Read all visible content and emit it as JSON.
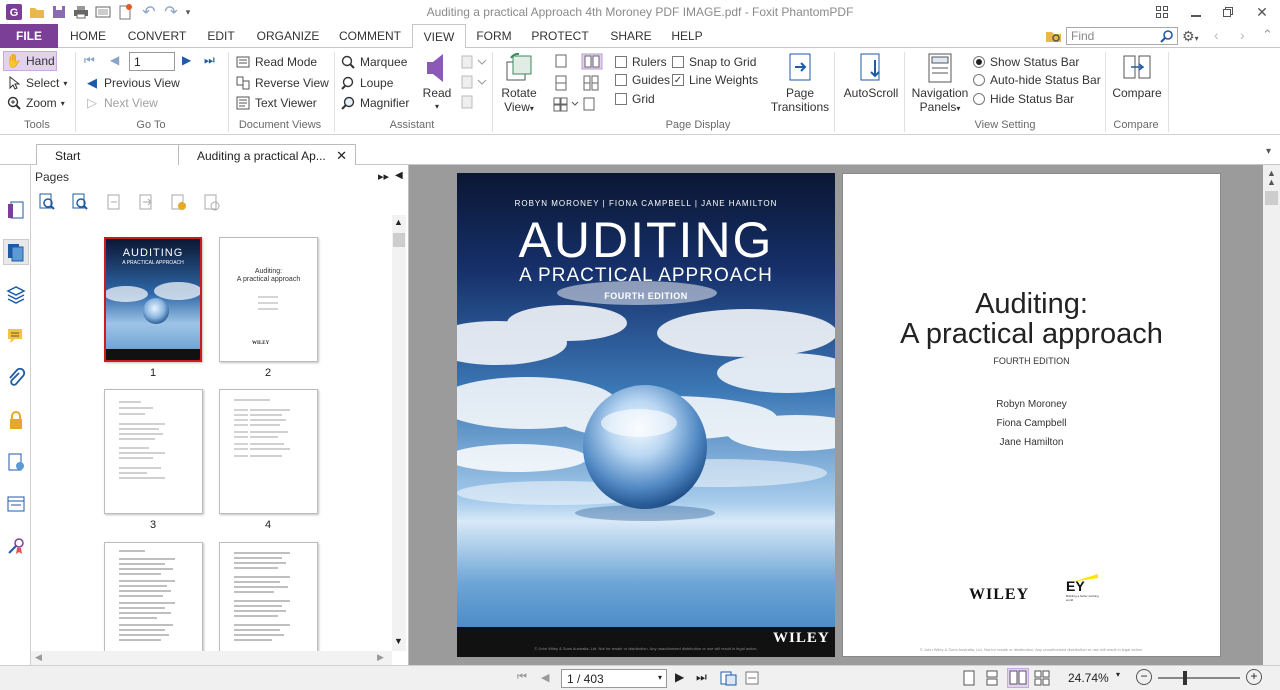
{
  "window": {
    "title": "Auditing a practical Approach 4th Moroney PDF IMAGE.pdf - Foxit PhantomPDF"
  },
  "menu": {
    "file": "FILE",
    "tabs": [
      "HOME",
      "CONVERT",
      "EDIT",
      "ORGANIZE",
      "COMMENT",
      "VIEW",
      "FORM",
      "PROTECT",
      "SHARE",
      "HELP"
    ],
    "active_tab": "VIEW",
    "find_placeholder": "Find"
  },
  "ribbon": {
    "tools": {
      "hand": "Hand",
      "select": "Select",
      "zoom": "Zoom",
      "label": "Tools"
    },
    "goto": {
      "page_value": "1",
      "previous_view": "Previous View",
      "next_view": "Next View",
      "label": "Go To"
    },
    "document_views": {
      "read_mode": "Read Mode",
      "reverse_view": "Reverse View",
      "text_viewer": "Text Viewer",
      "label": "Document Views"
    },
    "assistant": {
      "marquee": "Marquee",
      "loupe": "Loupe",
      "magnifier": "Magnifier",
      "read": "Read",
      "label": "Assistant"
    },
    "page_display": {
      "rotate_view_1": "Rotate",
      "rotate_view_2": "View",
      "rulers": "Rulers",
      "guides": "Guides",
      "grid": "Grid",
      "snap_to_grid": "Snap to Grid",
      "line_weights": "Line Weights",
      "page_transitions_1": "Page",
      "page_transitions_2": "Transitions",
      "label": "Page Display"
    },
    "autoscroll": "AutoScroll",
    "view_setting": {
      "nav_panels_1": "Navigation",
      "nav_panels_2": "Panels",
      "show_status_bar": "Show Status Bar",
      "autohide_status_bar": "Auto-hide Status Bar",
      "hide_status_bar": "Hide Status Bar",
      "label": "View Setting"
    },
    "compare": {
      "button": "Compare",
      "label": "Compare"
    }
  },
  "doc_tabs": {
    "start": "Start",
    "current": "Auditing a practical Ap..."
  },
  "pages_panel": {
    "title": "Pages",
    "thumb_numbers": [
      "1",
      "2",
      "3",
      "4"
    ]
  },
  "cover": {
    "authors": "ROBYN MORONEY | FIONA CAMPBELL | JANE HAMILTON",
    "title": "AUDITING",
    "subtitle": "A PRACTICAL APPROACH",
    "edition": "FOURTH EDITION",
    "publisher": "WILEY",
    "footer": "© John Wiley & Sons Australia, Ltd. Not for resale or distribution. Any unauthorised distribution or use will result in legal action."
  },
  "title_page": {
    "title_line1": "Auditing:",
    "title_line2": "A practical approach",
    "edition": "FOURTH EDITION",
    "authors": [
      "Robyn Moroney",
      "Fiona Campbell",
      "Jane Hamilton"
    ],
    "publisher": "WILEY",
    "ey": "EY",
    "ey_tagline": "Building a better working world",
    "footer": "© John Wiley & Sons Australia, Ltd. Not for resale or distribution. Any unauthorised distribution or use will result in legal action."
  },
  "thumb2": {
    "title_line1": "Auditing:",
    "title_line2": "A practical approach",
    "publisher": "WILEY"
  },
  "thumb1": {
    "title": "AUDITING",
    "subtitle": "A PRACTICAL APPROACH"
  },
  "statusbar": {
    "page_indicator": "1 / 403",
    "zoom": "24.74%",
    "zoom_fraction": 0.33
  },
  "colors": {
    "file_tab": "#7b3f98",
    "hand_highlight": "#e2d2ee",
    "cover_top": "#0b1733"
  }
}
